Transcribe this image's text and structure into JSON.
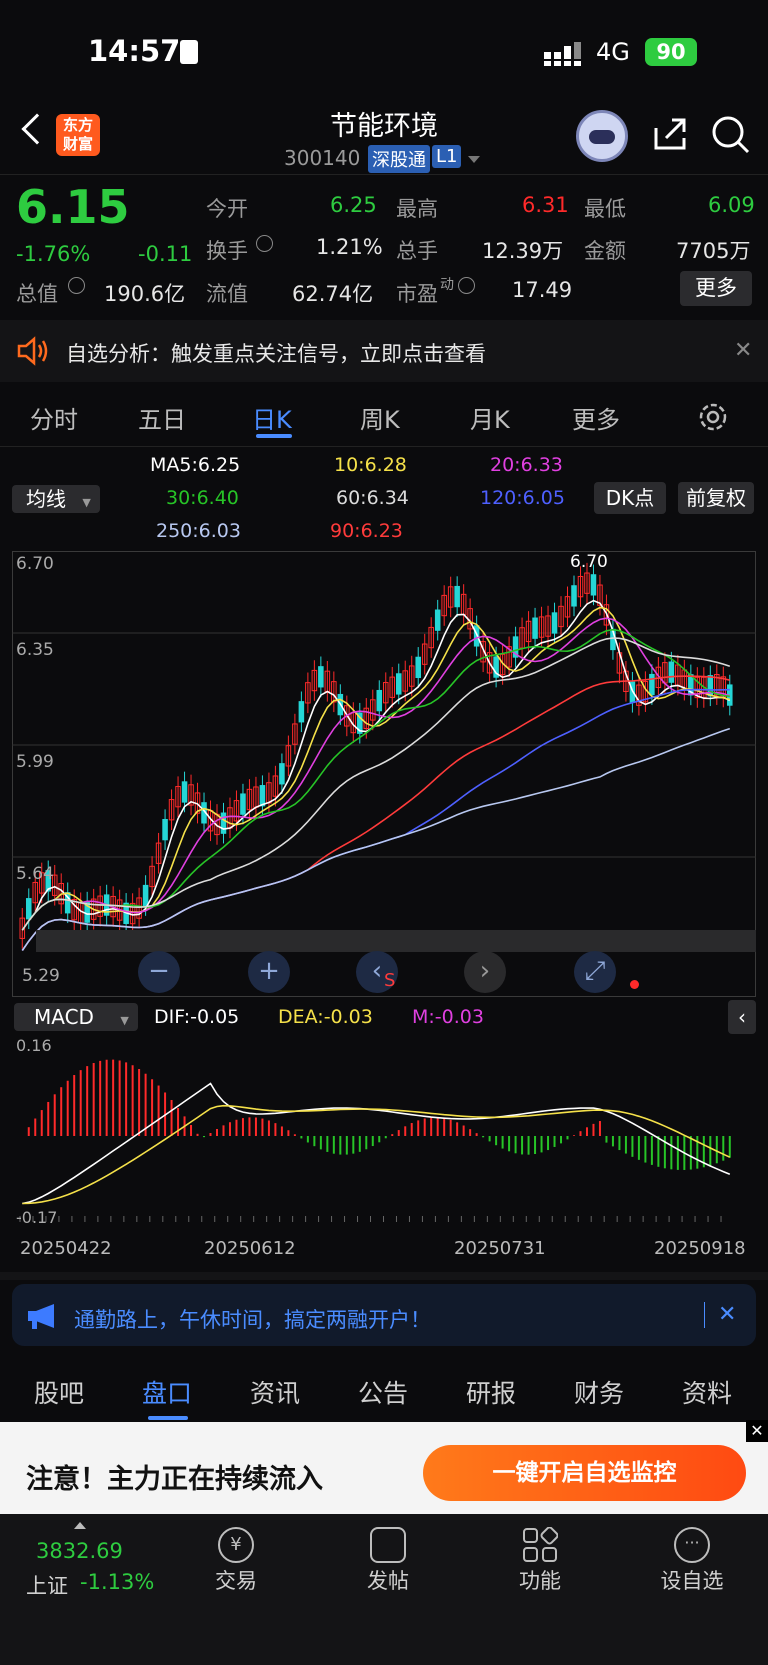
{
  "status_bar": {
    "time": "14:57",
    "network": "4G",
    "battery": "90"
  },
  "header": {
    "title": "节能环境",
    "code": "300140",
    "badge": "深股通",
    "level": "L1",
    "logo_line1": "东方",
    "logo_line2": "财富"
  },
  "quote": {
    "price": "6.15",
    "change_pct": "-1.76%",
    "change": "-0.11",
    "open_label": "今开",
    "open": "6.25",
    "high_label": "最高",
    "high": "6.31",
    "low_label": "最低",
    "low": "6.09",
    "turnover_label": "换手",
    "turnover": "1.21%",
    "volume_label": "总手",
    "volume": "12.39万",
    "amount_label": "金额",
    "amount": "7705万",
    "mktcap_label": "总值",
    "mktcap": "190.6亿",
    "float_label": "流值",
    "float": "62.74亿",
    "pe_label": "市盈",
    "pe_sup": "动",
    "pe": "17.49",
    "more_label": "更多"
  },
  "notice": {
    "text": "自选分析：触发重点关注信号，立即点击查看"
  },
  "period_tabs": [
    {
      "label": "分时"
    },
    {
      "label": "五日"
    },
    {
      "label": "日K"
    },
    {
      "label": "周K"
    },
    {
      "label": "月K"
    },
    {
      "label": "更多"
    }
  ],
  "ma_legend": {
    "select_label": "均线",
    "ma5": "MA5:6.25",
    "ma10": "10:6.28",
    "ma20": "20:6.33",
    "ma30": "30:6.40",
    "ma60": "60:6.34",
    "ma120": "120:6.05",
    "ma250": "250:6.03",
    "ma90": "90:6.23",
    "dk_label": "DK点",
    "fq_label": "前复权"
  },
  "colors": {
    "ma5": "#ffffff",
    "ma10": "#f5e14a",
    "ma20": "#e040e0",
    "ma30": "#27c427",
    "ma60": "#dcdcdc",
    "ma120": "#4e60ff",
    "ma250": "#b8c8f0",
    "ma90": "#ff3b3b",
    "up": "#ff2a2a",
    "down": "#25d6d6"
  },
  "price_axis": {
    "high_label": "6.70",
    "l1": "6.35",
    "l2": "5.99",
    "l3": "5.64",
    "low_label": "5.29",
    "max_marker": "6.70"
  },
  "macd": {
    "select_label": "MACD",
    "dif": "DIF:-0.05",
    "dea": "DEA:-0.03",
    "m": "M:-0.03",
    "top": "0.16",
    "bottom": "-0.17",
    "dates": [
      "20250422",
      "20250612",
      "20250731",
      "20250918"
    ]
  },
  "banner": {
    "text": "通勤路上，午休时间，搞定两融开户！"
  },
  "bottom_tabs": [
    {
      "label": "股吧"
    },
    {
      "label": "盘口"
    },
    {
      "label": "资讯"
    },
    {
      "label": "公告"
    },
    {
      "label": "研报"
    },
    {
      "label": "财务"
    },
    {
      "label": "资料"
    }
  ],
  "promo": {
    "text": "注意！主力正在持续流入",
    "button": "一键开启自选监控"
  },
  "index": {
    "value": "3832.69",
    "name": "上证",
    "change": "-1.13%"
  },
  "nav": [
    {
      "label": "交易"
    },
    {
      "label": "发帖"
    },
    {
      "label": "功能"
    },
    {
      "label": "设自选"
    }
  ]
}
